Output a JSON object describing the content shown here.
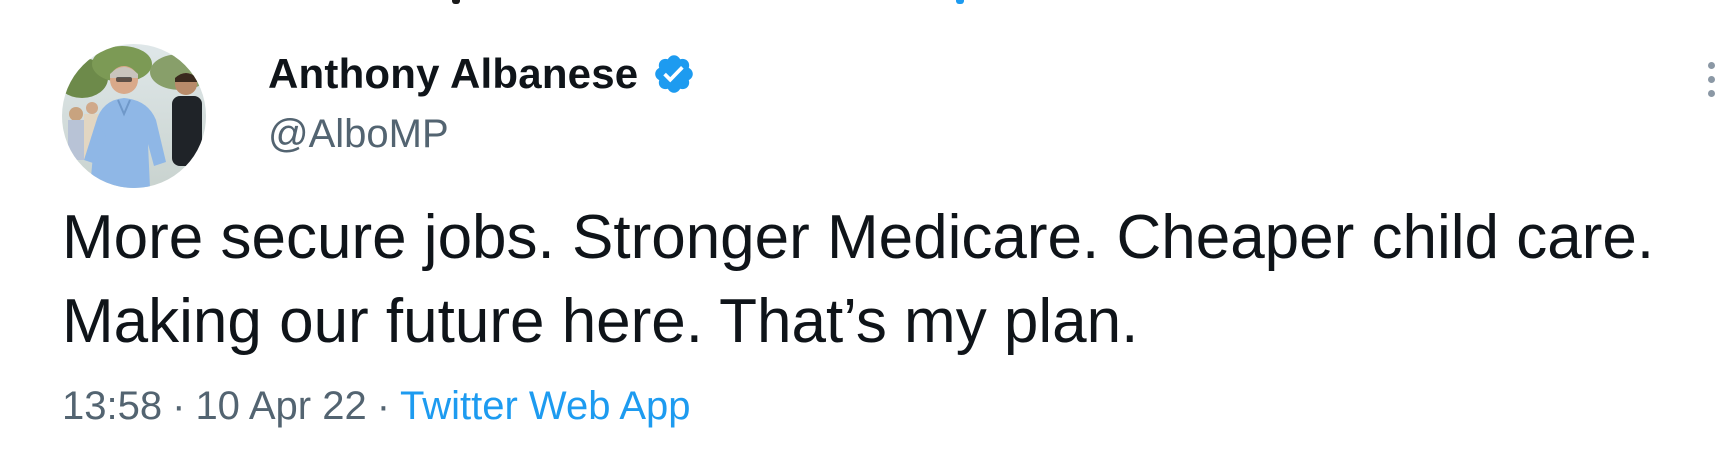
{
  "tweet": {
    "author": {
      "display_name": "Anthony Albanese",
      "handle": "@AlboMP",
      "verified": true,
      "avatar_icon": "profile-photo"
    },
    "text": "More secure jobs. Stronger Medicare. Cheaper child care. Making our future here. That’s my plan.",
    "meta": {
      "time": "13:58",
      "separator": "·",
      "date": "10 Apr 22",
      "source": "Twitter Web App"
    }
  },
  "colors": {
    "text_primary": "#0f1419",
    "text_secondary": "#536471",
    "accent": "#1d9bf0",
    "verified_badge": "#1d9bf0"
  },
  "icons": {
    "verified": "verified-badge-icon",
    "more": "more-vertical-icon"
  }
}
